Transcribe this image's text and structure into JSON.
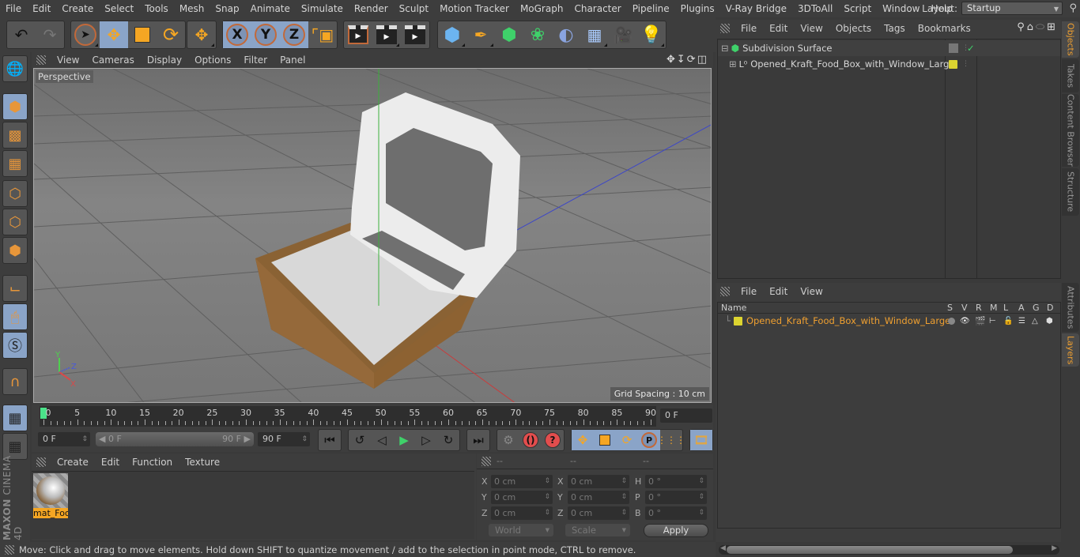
{
  "menubar": {
    "items": [
      "File",
      "Edit",
      "Create",
      "Select",
      "Tools",
      "Mesh",
      "Snap",
      "Animate",
      "Simulate",
      "Render",
      "Sculpt",
      "Motion Tracker",
      "MoGraph",
      "Character",
      "Pipeline",
      "Plugins",
      "V-Ray Bridge",
      "3DToAll",
      "Script",
      "Window",
      "Help"
    ],
    "layout_label": "Layout:",
    "layout_value": "Startup"
  },
  "toolbar": {
    "undo": "undo-icon",
    "redo": "redo-icon",
    "tools": [
      "live-selection",
      "move",
      "scale",
      "rotate",
      "last-tool"
    ],
    "axes": [
      "X",
      "Y",
      "Z"
    ],
    "coord_system": "world-coordinate-icon",
    "render": [
      "render-view",
      "render-picture-viewer",
      "render-settings"
    ],
    "create": [
      "cube",
      "pen-spline",
      "subdivision-generator",
      "mograph-cloner",
      "deformer-bend",
      "floor-environment",
      "camera",
      "light"
    ]
  },
  "left_tools": [
    "make-editable",
    "texture-mode",
    "workplane-mode",
    "points-mode",
    "edges-mode",
    "polygons-mode",
    "axis-mode",
    "tweak-mode",
    "solo-mode",
    "snapping",
    "locked-workplane",
    "planar-workplane"
  ],
  "brand": {
    "maker": "MAXON",
    "product": "CINEMA 4D"
  },
  "viewport": {
    "menu": [
      "View",
      "Cameras",
      "Display",
      "Options",
      "Filter",
      "Panel"
    ],
    "camera_label": "Perspective",
    "grid_spacing": "Grid Spacing : 10 cm",
    "axis_labels": {
      "x": "X",
      "y": "Y",
      "z": "Z"
    }
  },
  "timeline": {
    "ticks": [
      "0",
      "5",
      "10",
      "15",
      "20",
      "25",
      "30",
      "35",
      "40",
      "45",
      "50",
      "55",
      "60",
      "65",
      "70",
      "75",
      "80",
      "85",
      "90"
    ],
    "current_frame_display": "0 F",
    "start_field": "0 F",
    "range_start": "0 F",
    "range_end": "90 F",
    "end_field": "90 F"
  },
  "material_manager": {
    "menu": [
      "Create",
      "Edit",
      "Function",
      "Texture"
    ],
    "materials": [
      {
        "name": "mat_Foc"
      }
    ]
  },
  "coordinates": {
    "headers": [
      "--",
      "--",
      "--"
    ],
    "rows": [
      {
        "l1": "X",
        "v1": "0 cm",
        "l2": "X",
        "v2": "0 cm",
        "l3": "H",
        "v3": "0 °"
      },
      {
        "l1": "Y",
        "v1": "0 cm",
        "l2": "Y",
        "v2": "0 cm",
        "l3": "P",
        "v3": "0 °"
      },
      {
        "l1": "Z",
        "v1": "0 cm",
        "l2": "Z",
        "v2": "0 cm",
        "l3": "B",
        "v3": "0 °"
      }
    ],
    "space_dropdown": "World",
    "mode_dropdown": "Scale",
    "apply_label": "Apply"
  },
  "status": "Move: Click and drag to move elements. Hold down SHIFT to quantize movement / add to the selection in point mode, CTRL to remove.",
  "object_manager": {
    "menu": [
      "File",
      "Edit",
      "View",
      "Objects",
      "Tags",
      "Bookmarks"
    ],
    "objects": [
      {
        "name": "Subdivision Surface",
        "color": "#3fd16a"
      },
      {
        "name": "Opened_Kraft_Food_Box_with_Window_Large",
        "color": "#dcd430"
      }
    ]
  },
  "layer_manager": {
    "menu": [
      "File",
      "Edit",
      "View"
    ],
    "columns": [
      "Name",
      "S",
      "V",
      "R",
      "M",
      "L",
      "A",
      "G",
      "D"
    ],
    "layers": [
      {
        "name": "Opened_Kraft_Food_Box_with_Window_Large",
        "color": "#dcd430",
        "text_color": "#f0a030"
      }
    ],
    "scroll_fraction": 0.88
  },
  "side_tabs": {
    "top": [
      "Objects",
      "Takes",
      "Content Browser",
      "Structure"
    ],
    "bottom": [
      "Attributes",
      "Layers"
    ],
    "active_top": "Objects",
    "active_bottom": "Layers"
  },
  "colors": {
    "accent": "#f0a030",
    "selected_bg": "#8aa4c8",
    "playhead": "#4be38a"
  }
}
